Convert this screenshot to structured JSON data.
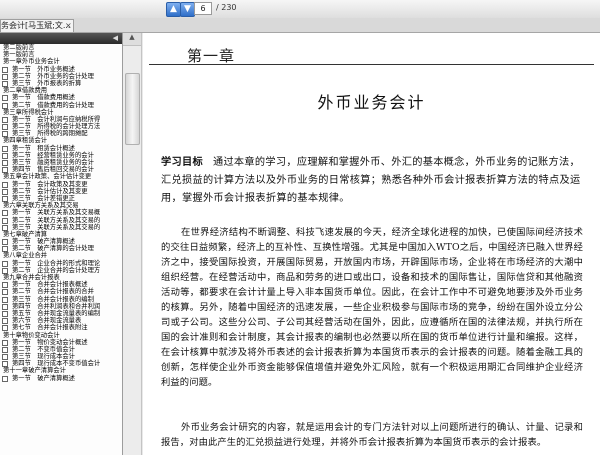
{
  "toolbar": {
    "up_icon": "arrow-up-icon",
    "down_icon": "arrow-down-icon",
    "current_page": "6",
    "total_pages": "/ 230"
  },
  "tab": {
    "label": "务会计[马玉斌;文...",
    "close": "×"
  },
  "sidebar": {
    "items": [
      {
        "label": "第二版前言",
        "level": 0
      },
      {
        "label": "第一版前言",
        "level": 0
      },
      {
        "label": "第一章外币业务会计",
        "level": 0
      },
      {
        "label": "第一节　外币业务概述",
        "level": 1
      },
      {
        "label": "第二节　外币业务的会计处理",
        "level": 1
      },
      {
        "label": "第三节　外币报表的折算",
        "level": 1
      },
      {
        "label": "第二章借款费用",
        "level": 0
      },
      {
        "label": "第一节　借款费用概述",
        "level": 1
      },
      {
        "label": "第二节　借款费用的会计处理",
        "level": 1
      },
      {
        "label": "第三章所得税会计",
        "level": 0
      },
      {
        "label": "第一节　会计利润与应纳税所得",
        "level": 1
      },
      {
        "label": "第二节　所得税的会计处理方法",
        "level": 1
      },
      {
        "label": "第三节　所得税的跨期摊配",
        "level": 1
      },
      {
        "label": "第四章租赁会计",
        "level": 0
      },
      {
        "label": "第一节　租赁会计概述",
        "level": 1
      },
      {
        "label": "第二节　经营租赁业务的会计",
        "level": 1
      },
      {
        "label": "第三节　融资租赁业务的会计",
        "level": 1
      },
      {
        "label": "第四节　售后租回交易的会计",
        "level": 1
      },
      {
        "label": "第五章会计政策、会计估计变更",
        "level": 0
      },
      {
        "label": "第一节　会计政策及其变更",
        "level": 1
      },
      {
        "label": "第二节　会计估计及其变更",
        "level": 1
      },
      {
        "label": "第三节　会计差错更正",
        "level": 1
      },
      {
        "label": "第六章关联方关系及其交易",
        "level": 0
      },
      {
        "label": "第一节　关联方关系及其交易概",
        "level": 1
      },
      {
        "label": "第二节　关联方关系及其交易的",
        "level": 1
      },
      {
        "label": "第三节　关联方关系及其交易的",
        "level": 1
      },
      {
        "label": "第七章破产清算",
        "level": 0
      },
      {
        "label": "第一节　破产清算概述",
        "level": 1
      },
      {
        "label": "第二节　破产清算的会计处理",
        "level": 1
      },
      {
        "label": "第八章企业合并",
        "level": 0
      },
      {
        "label": "第一节　企业合并的形式和理论",
        "level": 1
      },
      {
        "label": "第二节　企业合并的会计处理方",
        "level": 1
      },
      {
        "label": "第九章合并会计报表",
        "level": 0
      },
      {
        "label": "第一节　合并会计报表概述",
        "level": 1
      },
      {
        "label": "第二节　合并会计报表的合并",
        "level": 1
      },
      {
        "label": "第三节　合并会计报表的编制",
        "level": 1
      },
      {
        "label": "第四节　合并利润表和合并利润",
        "level": 1
      },
      {
        "label": "第五节　合并现金流量表的编制",
        "level": 1
      },
      {
        "label": "第六节　合并现金流量表",
        "level": 1
      },
      {
        "label": "第七节　合并会计报表附注",
        "level": 1
      },
      {
        "label": "第十章物价变动会计",
        "level": 0
      },
      {
        "label": "第一节　物价变动会计概述",
        "level": 1
      },
      {
        "label": "第二节　不变币值会计",
        "level": 1
      },
      {
        "label": "第三节　现行成本会计",
        "level": 1
      },
      {
        "label": "第四节　现行成本不变币值会计",
        "level": 1
      },
      {
        "label": "第十一章破产清算会计",
        "level": 0
      },
      {
        "label": "第一节　破产清算概述",
        "level": 1
      }
    ]
  },
  "page": {
    "chapter_title": "第一章",
    "section_title": "外币业务会计",
    "objectives_label": "学习目标",
    "objectives_text": "通过本章的学习，应理解和掌握外币、外汇的基本概念，外币业务的记账方法，汇兑损益的计算方法以及外币业务的日常核算；熟悉各种外币会计报表折算方法的特点及运用，掌握外币会计报表折算的基本规律。",
    "paragraphs": [
      "在世界经济结构不断调整、科技飞速发展的今天，经济全球化进程的加快，已使国际间经济技术的交往日益频繁，经济上的互补性、互换性增强。尤其是中国加入WTO之后，中国经济已融入世界经济之中，接受国际投资，开展国际贸易，开放国内市场，开辟国际市场，企业将在市场经济的大潮中组织经营。在经营活动中，商品和劳务的进口或出口，设备和技术的国际售让，国际信贷和其他融资活动等，都要求在会计计量上导入非本国货币单位。因此，在会计工作中不可避免地要涉及外币业务的核算。另外，随着中国经济的迅速发展，一些企业积极参与国际市场的竞争，纷纷在国外设立分公司或子公司。这些分公司、子公司其经营活动在国外，因此，应遵循所在国的法律法规，并执行所在国的会计准则和会计制度，其会计报表的编制也必然要以所在国的货币单位进行计量和编报。这样，在会计核算中就涉及将外币表述的会计报表折算为本国货币表示的会计报表的问题。随着金融工具的创新，怎样使企业外币资金能够保值增值并避免外汇风险，就有一个积极运用期汇合同维护企业经济利益的问题。",
      "外币业务会计研究的内容，就是运用会计的专门方法针对以上问题所进行的确认、计量、记录和报告，对由此产生的汇兑损益进行处理，并将外币会计报表折算为本国货币表示的会计报表。"
    ]
  }
}
